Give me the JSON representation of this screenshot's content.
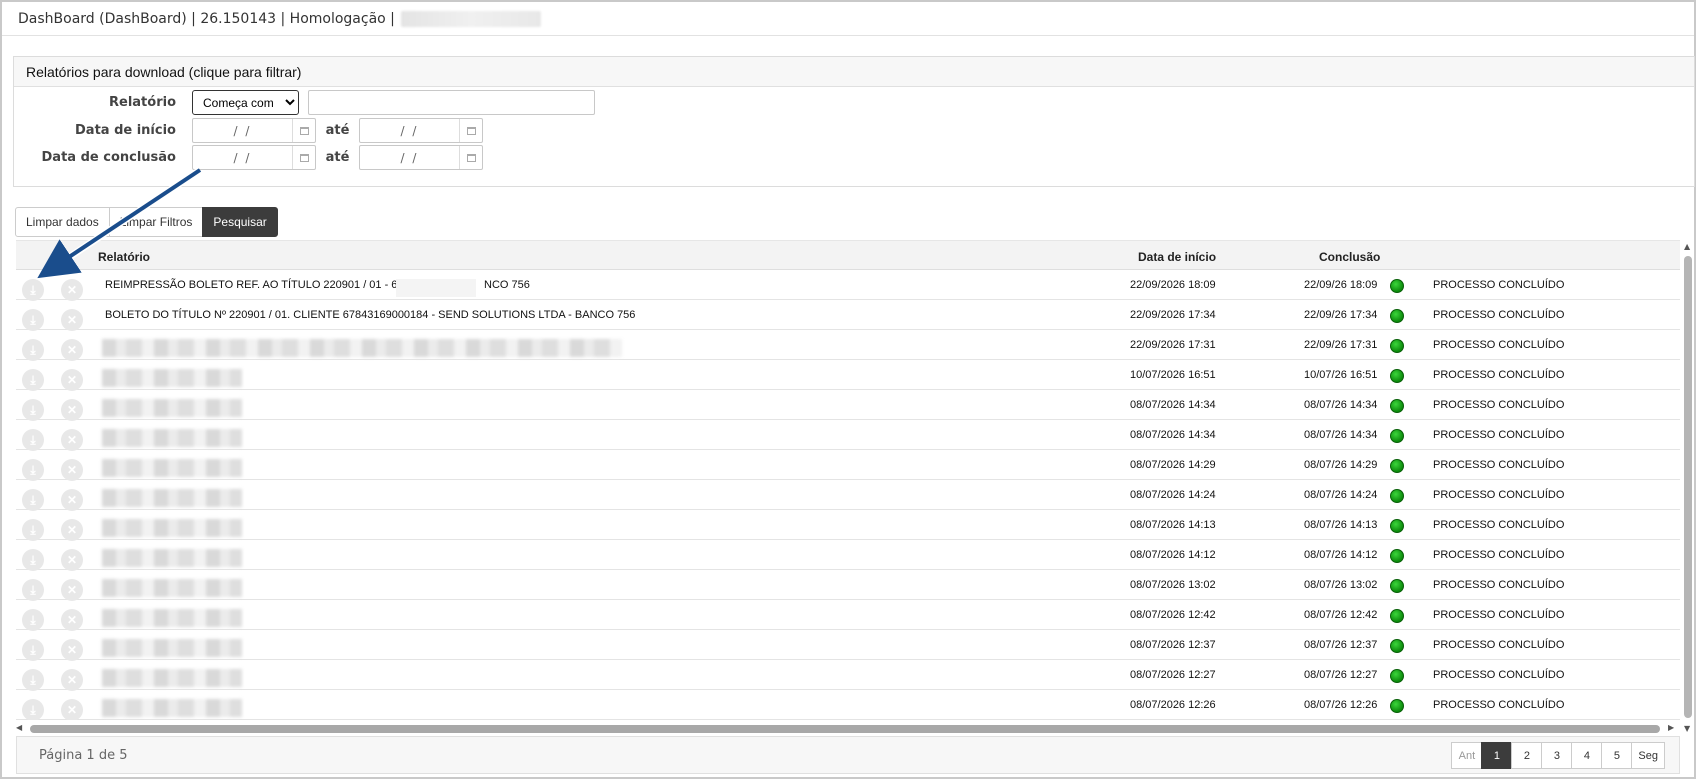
{
  "window": {
    "title": "DashBoard (DashBoard) | 26.150143 | Homologação |"
  },
  "filter_panel": {
    "header": "Relatórios para download (clique para filtrar)",
    "relatorio_label": "Relatório",
    "match_options": [
      "Começa com"
    ],
    "match_selected": "Começa com",
    "data_inicio_label": "Data de início",
    "data_conclusao_label": "Data de conclusão",
    "ate_label": "até",
    "date_placeholder": "/ /"
  },
  "buttons": {
    "limpar_dados": "Limpar dados",
    "limpar_filtros": "Limpar Filtros",
    "pesquisar": "Pesquisar"
  },
  "grid": {
    "headers": {
      "relatorio": "Relatório",
      "data_inicio": "Data de início",
      "conclusao": "Conclusão"
    },
    "rows": [
      {
        "name": "REIMPRESSÃO BOLETO REF. AO TÍTULO 220901 / 01 - 67",
        "name_tail": "NCO 756",
        "start": "22/09/2026 18:09",
        "end": "22/09/26 18:09",
        "status": "PROCESSO CONCLUÍDO"
      },
      {
        "name": "BOLETO DO TÍTULO Nº 220901 / 01. CLIENTE 67843169000184 - SEND SOLUTIONS LTDA - BANCO 756",
        "start": "22/09/2026 17:34",
        "end": "22/09/26 17:34",
        "status": "PROCESSO CONCLUÍDO"
      },
      {
        "name": "",
        "start": "22/09/2026 17:31",
        "end": "22/09/26 17:31",
        "status": "PROCESSO CONCLUÍDO"
      },
      {
        "name": "",
        "start": "10/07/2026 16:51",
        "end": "10/07/26 16:51",
        "status": "PROCESSO CONCLUÍDO"
      },
      {
        "name": "",
        "start": "08/07/2026 14:34",
        "end": "08/07/26 14:34",
        "status": "PROCESSO CONCLUÍDO"
      },
      {
        "name": "",
        "start": "08/07/2026 14:34",
        "end": "08/07/26 14:34",
        "status": "PROCESSO CONCLUÍDO"
      },
      {
        "name": "",
        "start": "08/07/2026 14:29",
        "end": "08/07/26 14:29",
        "status": "PROCESSO CONCLUÍDO"
      },
      {
        "name": "",
        "start": "08/07/2026 14:24",
        "end": "08/07/26 14:24",
        "status": "PROCESSO CONCLUÍDO"
      },
      {
        "name": "",
        "start": "08/07/2026 14:13",
        "end": "08/07/26 14:13",
        "status": "PROCESSO CONCLUÍDO"
      },
      {
        "name": "",
        "start": "08/07/2026 14:12",
        "end": "08/07/26 14:12",
        "status": "PROCESSO CONCLUÍDO"
      },
      {
        "name": "",
        "start": "08/07/2026 13:02",
        "end": "08/07/26 13:02",
        "status": "PROCESSO CONCLUÍDO"
      },
      {
        "name": "",
        "start": "08/07/2026 12:42",
        "end": "08/07/26 12:42",
        "status": "PROCESSO CONCLUÍDO"
      },
      {
        "name": "",
        "start": "08/07/2026 12:37",
        "end": "08/07/26 12:37",
        "status": "PROCESSO CONCLUÍDO"
      },
      {
        "name": "",
        "start": "08/07/2026 12:27",
        "end": "08/07/26 12:27",
        "status": "PROCESSO CONCLUÍDO"
      },
      {
        "name": "",
        "start": "08/07/2026 12:26",
        "end": "08/07/26 12:26",
        "status": "PROCESSO CONCLUÍDO"
      }
    ]
  },
  "pagination": {
    "info": "Página 1 de 5",
    "prev": "Ant",
    "next": "Seg",
    "pages": [
      "1",
      "2",
      "3",
      "4",
      "5"
    ],
    "current": "1"
  },
  "colors": {
    "status_ok": "#0c8a0c",
    "active_button": "#3c3c3c",
    "annotation_arrow": "#1a4d8c"
  },
  "icons": {
    "download": "download-icon",
    "cancel": "close-icon",
    "calendar": "calendar-icon",
    "status": "status-dot-icon"
  }
}
